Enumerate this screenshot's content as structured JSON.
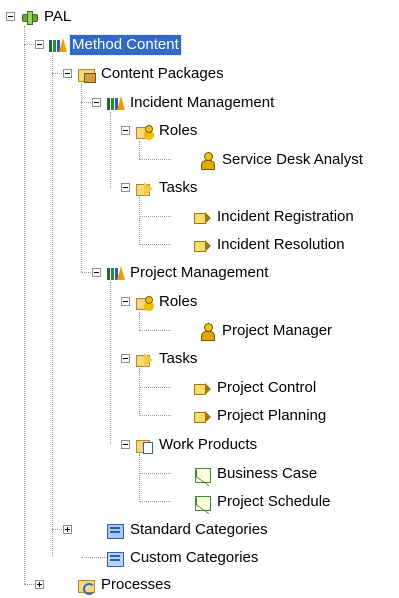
{
  "tree": {
    "plugin": {
      "label": "PAL",
      "icon": "plugin-icon"
    },
    "method_content": {
      "label": "Method Content",
      "icon": "method-library-icon"
    },
    "content_packages": {
      "label": "Content Packages",
      "icon": "content-package-folder-icon"
    },
    "incident_management": {
      "label": "Incident Management",
      "icon": "method-library-icon"
    },
    "im_roles": {
      "label": "Roles",
      "icon": "roles-folder-icon"
    },
    "im_role_1": {
      "label": "Service Desk Analyst",
      "icon": "role-icon"
    },
    "im_tasks": {
      "label": "Tasks",
      "icon": "tasks-folder-icon"
    },
    "im_task_1": {
      "label": "Incident Registration",
      "icon": "task-icon"
    },
    "im_task_2": {
      "label": "Incident Resolution",
      "icon": "task-icon"
    },
    "project_management": {
      "label": "Project Management",
      "icon": "method-library-icon"
    },
    "pm_roles": {
      "label": "Roles",
      "icon": "roles-folder-icon"
    },
    "pm_role_1": {
      "label": "Project Manager",
      "icon": "role-icon"
    },
    "pm_tasks": {
      "label": "Tasks",
      "icon": "tasks-folder-icon"
    },
    "pm_task_1": {
      "label": "Project Control",
      "icon": "task-icon"
    },
    "pm_task_2": {
      "label": "Project Planning",
      "icon": "task-icon"
    },
    "pm_work_products": {
      "label": "Work Products",
      "icon": "work-products-folder-icon"
    },
    "pm_wp_1": {
      "label": "Business Case",
      "icon": "artifact-icon"
    },
    "pm_wp_2": {
      "label": "Project Schedule",
      "icon": "artifact-icon"
    },
    "standard_categories": {
      "label": "Standard Categories",
      "icon": "standard-categories-icon"
    },
    "custom_categories": {
      "label": "Custom Categories",
      "icon": "custom-categories-icon"
    },
    "processes": {
      "label": "Processes",
      "icon": "processes-icon"
    }
  },
  "colors": {
    "selection": "#316ac5",
    "selection_text": "#ffffff"
  }
}
